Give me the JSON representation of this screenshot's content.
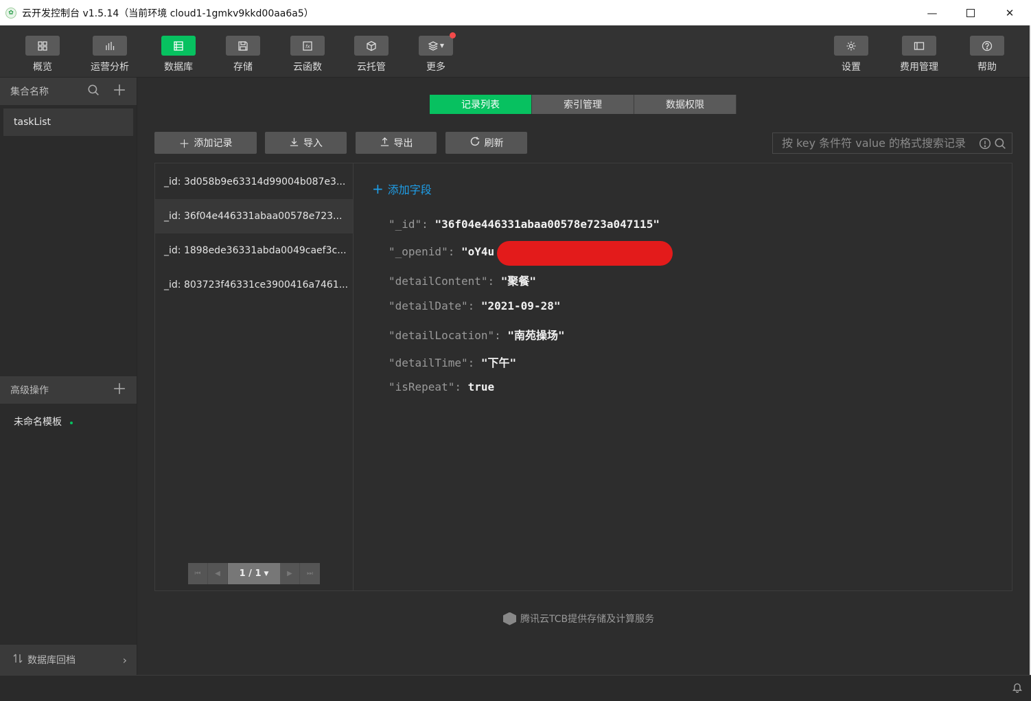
{
  "window": {
    "title": "云开发控制台 v1.5.14（当前环境 cloud1-1gmkv9kkd00aa6a5）",
    "minimize": "—",
    "close": "✕"
  },
  "toolbar": {
    "left": [
      {
        "label": "概览",
        "icon": "grid-icon"
      },
      {
        "label": "运营分析",
        "icon": "bar-chart-icon"
      },
      {
        "label": "数据库",
        "icon": "database-icon",
        "active": true
      },
      {
        "label": "存储",
        "icon": "storage-icon"
      },
      {
        "label": "云函数",
        "icon": "function-icon"
      },
      {
        "label": "云托管",
        "icon": "cube-icon"
      },
      {
        "label": "更多",
        "icon": "layers-icon",
        "notification_dot": true
      }
    ],
    "right": [
      {
        "label": "设置",
        "icon": "gear-icon"
      },
      {
        "label": "费用管理",
        "icon": "billing-icon"
      },
      {
        "label": "帮助",
        "icon": "help-icon"
      }
    ]
  },
  "sidebar": {
    "collections_header": "集合名称",
    "collections": [
      "taskList"
    ],
    "advanced_header": "高级操作",
    "templates": [
      "未命名模板"
    ],
    "footer": "数据库回档"
  },
  "tabs": [
    "记录列表",
    "索引管理",
    "数据权限"
  ],
  "actions": {
    "add_record": "添加记录",
    "import": "导入",
    "export": "导出",
    "refresh": "刷新"
  },
  "search": {
    "placeholder": "按 key 条件符 value 的格式搜索记录"
  },
  "records": [
    "_id: 3d058b9e63314d99004b087e3...",
    "_id: 36f04e446331abaa00578e723...",
    "_id: 1898ede36331abda0049caef3c...",
    "_id: 803723f46331ce3900416a7461..."
  ],
  "pagination": {
    "page": "1 / 1"
  },
  "detail": {
    "add_field": "添加字段",
    "fields": [
      {
        "key": "\"_id\":",
        "value": "\"36f04e446331abaa00578e723a047115\""
      },
      {
        "key": "\"_openid\":",
        "value": "\"oY4u"
      },
      {
        "key": "\"detailContent\":",
        "value": "\"聚餐\""
      },
      {
        "key": "\"detailDate\":",
        "value": "\"2021-09-28\""
      },
      {
        "key": "\"detailLocation\":",
        "value": "\"南苑操场\""
      },
      {
        "key": "\"detailTime\":",
        "value": "\"下午\""
      },
      {
        "key": "\"isRepeat\":",
        "value": "true"
      }
    ]
  },
  "footer_note": "腾讯云TCB提供存储及计算服务",
  "colors": {
    "accent": "#07c160",
    "link": "#1e9ee8",
    "redaction": "#e31b1b"
  }
}
